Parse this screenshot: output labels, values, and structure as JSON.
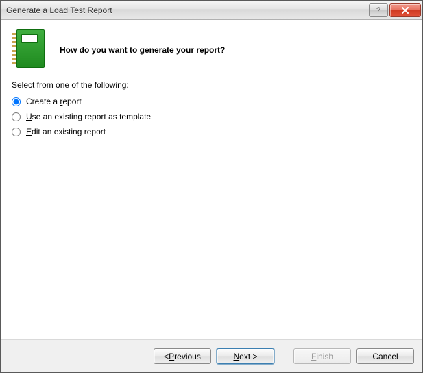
{
  "window": {
    "title": "Generate a Load Test Report"
  },
  "header": {
    "heading": "How do you want to generate your report?"
  },
  "content": {
    "prompt": "Select from one of the following:",
    "options": {
      "create": {
        "pre": "Create a ",
        "key": "r",
        "post": "eport"
      },
      "template": {
        "pre": "",
        "key": "U",
        "post": "se an existing report as template"
      },
      "edit": {
        "pre": "",
        "key": "E",
        "post": "dit an existing report"
      }
    },
    "selected": "create"
  },
  "footer": {
    "previous": {
      "pre": "< ",
      "key": "P",
      "post": "revious"
    },
    "next": {
      "pre": "",
      "key": "N",
      "post": "ext >"
    },
    "finish": {
      "pre": "",
      "key": "F",
      "post": "inish"
    },
    "cancel": "Cancel"
  }
}
